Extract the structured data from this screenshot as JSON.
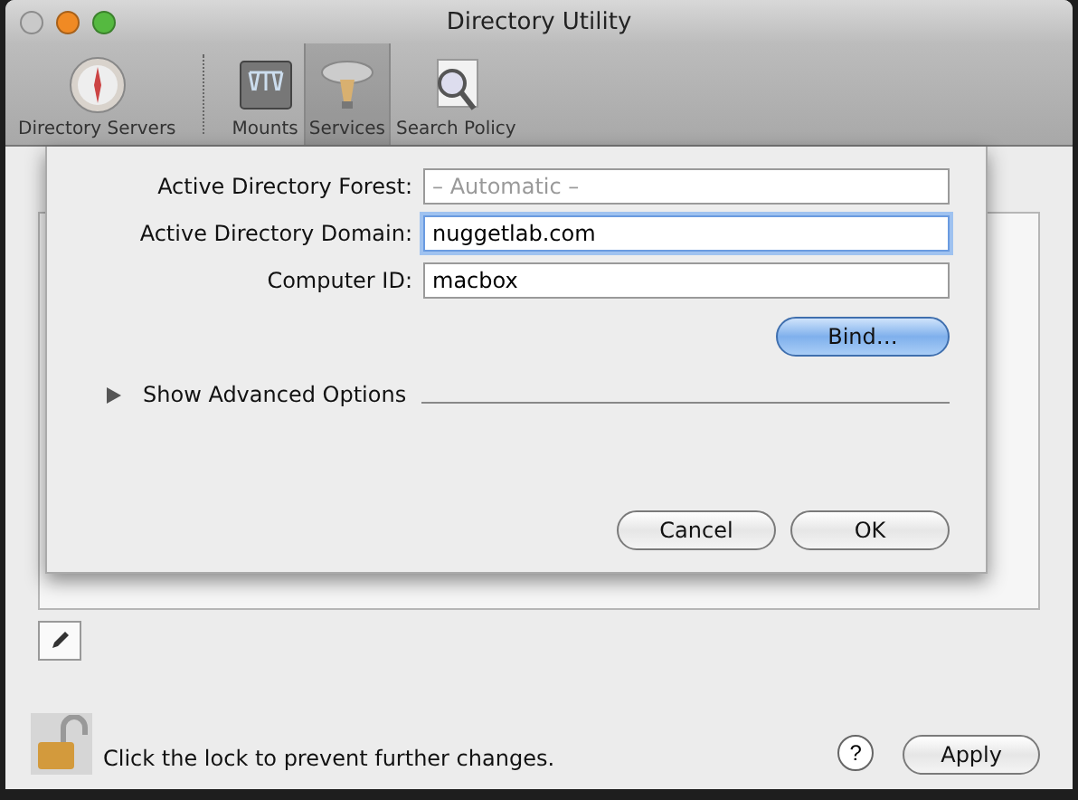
{
  "window": {
    "title": "Directory Utility"
  },
  "toolbar": {
    "items": [
      {
        "label": "Directory Servers",
        "selected": false
      },
      {
        "label": "Mounts",
        "selected": false
      },
      {
        "label": "Services",
        "selected": true
      },
      {
        "label": "Search Policy",
        "selected": false
      }
    ]
  },
  "sheet": {
    "fields": [
      {
        "label": "Active Directory Forest:",
        "placeholder": "– Automatic –",
        "focused": false
      },
      {
        "label": "Active Directory Domain:",
        "value": "nuggetlab.com",
        "focused": true
      },
      {
        "label": "Computer ID:",
        "value": "macbox",
        "focused": false
      }
    ],
    "bind_button": {
      "label": "Bind…",
      "default": true
    },
    "disclosure": {
      "label": "Show Advanced Options",
      "expanded": false
    },
    "buttons": [
      {
        "label": "Cancel",
        "default": false
      },
      {
        "label": "OK",
        "default": false
      }
    ]
  },
  "footer": {
    "locked": false,
    "lock_text": "Click the lock to prevent further changes.",
    "help_button": "?",
    "apply_button": "Apply"
  }
}
